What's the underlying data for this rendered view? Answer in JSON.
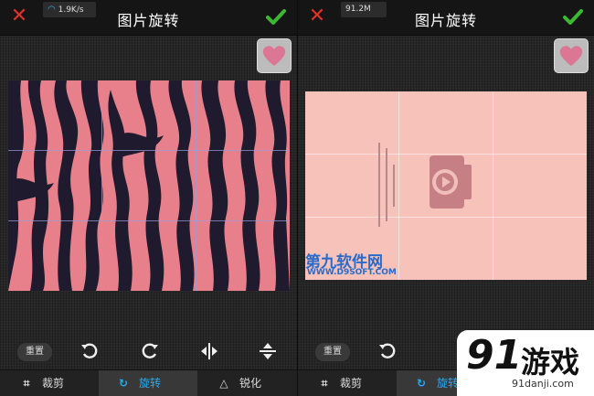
{
  "left": {
    "status": "1.9K/s",
    "title": "图片旋转",
    "reset_label": "重置",
    "tabs": [
      {
        "label": "裁剪",
        "active": false
      },
      {
        "label": "旋转",
        "active": true
      },
      {
        "label": "锐化",
        "active": false
      }
    ]
  },
  "right": {
    "status": "91.2M",
    "title": "图片旋转",
    "reset_label": "重置",
    "tabs": [
      {
        "label": "裁剪",
        "active": false
      },
      {
        "label": "旋转",
        "active": true
      }
    ]
  },
  "watermarks": {
    "site_cn": "第九软件网",
    "site_url": "WWW.D9SOFT.COM",
    "logo_number": "91",
    "logo_text": "游戏",
    "logo_url": "91danji.com"
  },
  "colors": {
    "accent": "#29aaf0",
    "close_red": "#e0312a",
    "check_green": "#3cb832",
    "zebra_pink": "#e8808c",
    "photo_pink": "#f7c2ba"
  }
}
